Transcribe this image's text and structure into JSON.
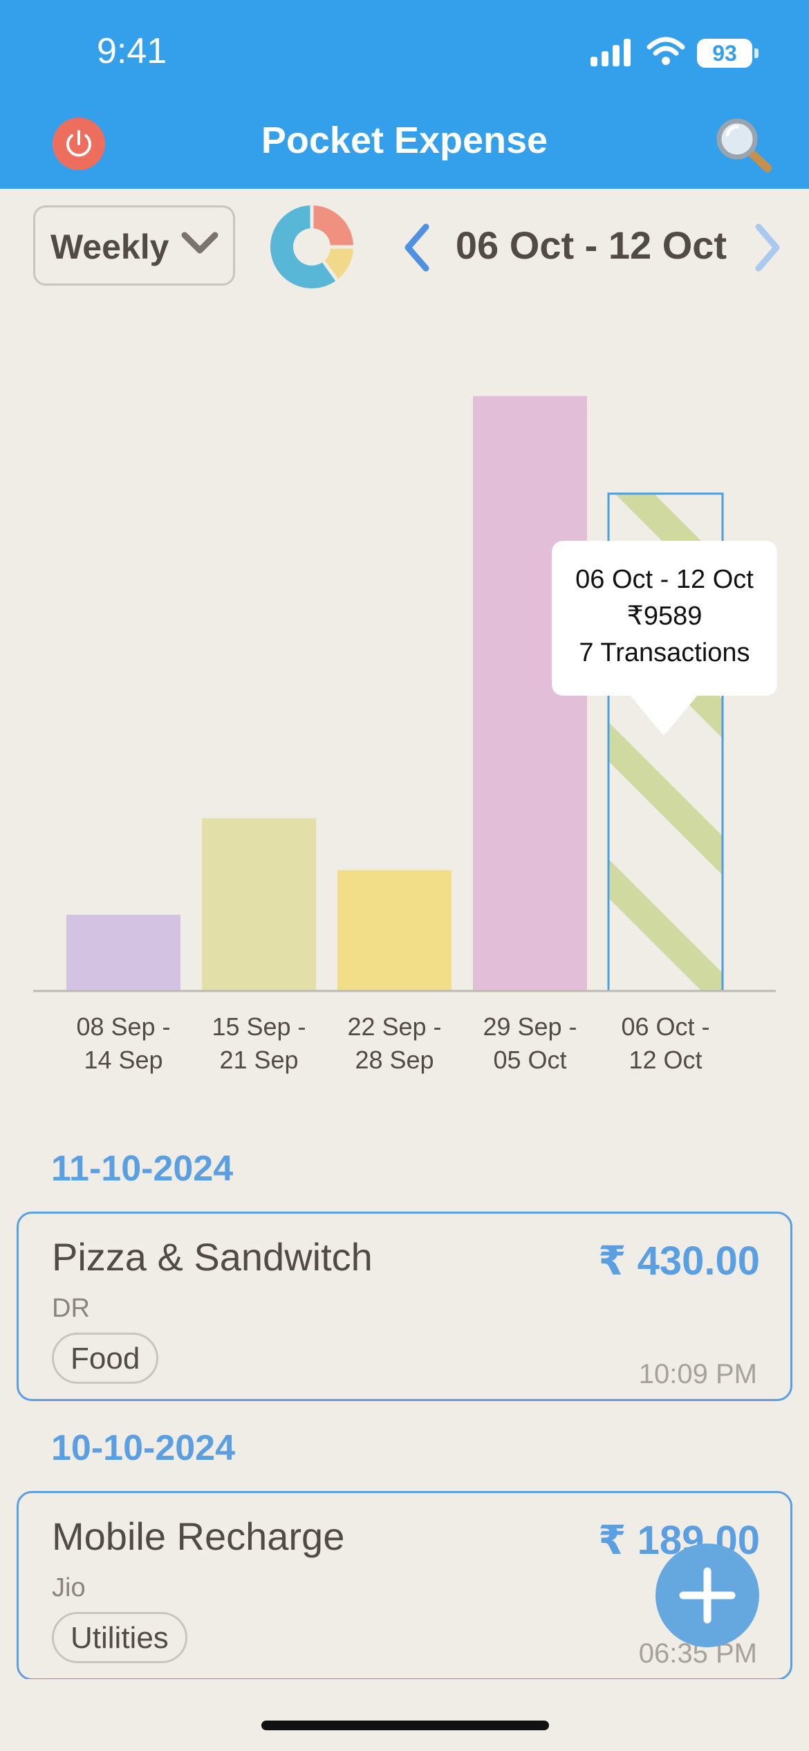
{
  "status_bar": {
    "time": "9:41",
    "battery": "93"
  },
  "header": {
    "title": "Pocket Expense",
    "power_icon": "power-icon",
    "search_icon": "search-icon"
  },
  "controls": {
    "period": "Weekly",
    "date_range": "06 Oct - 12 Oct"
  },
  "colors": {
    "header": "#34a0eb",
    "accent": "#5b9fe3",
    "fab": "#65a8e0",
    "power": "#ee6e5e"
  },
  "chart_data": {
    "type": "bar",
    "categories": [
      "08 Sep - 14 Sep",
      "15 Sep - 21 Sep",
      "22 Sep - 28 Sep",
      "29 Sep - 05 Oct",
      "06 Oct - 12 Oct"
    ],
    "category_lines": [
      [
        "08 Sep -",
        "14 Sep"
      ],
      [
        "15 Sep -",
        "21 Sep"
      ],
      [
        "22 Sep -",
        "28 Sep"
      ],
      [
        "29 Sep -",
        "05 Oct"
      ],
      [
        "06 Oct -",
        "12 Oct"
      ]
    ],
    "values": [
      1470,
      3330,
      2330,
      11470,
      9589
    ],
    "colors": [
      "#d3c2e1",
      "#e3dfa8",
      "#f2dd88",
      "#e3bed9",
      "#cfd9a0"
    ],
    "selected_index": 4,
    "ylim": [
      0,
      12000
    ],
    "grid": false,
    "tooltip": {
      "range": "06 Oct - 12 Oct",
      "amount": "₹9589",
      "transactions": "7 Transactions"
    }
  },
  "transactions": [
    {
      "date": "11-10-2024",
      "title": "Pizza & Sandwitch",
      "sub": "DR",
      "tag": "Food",
      "amount": "₹ 430.00",
      "time": "10:09 PM"
    },
    {
      "date": "10-10-2024",
      "title": "Mobile Recharge",
      "sub": "Jio",
      "tag": "Utilities",
      "amount": "₹ 189.00",
      "time": "06:35 PM"
    }
  ]
}
